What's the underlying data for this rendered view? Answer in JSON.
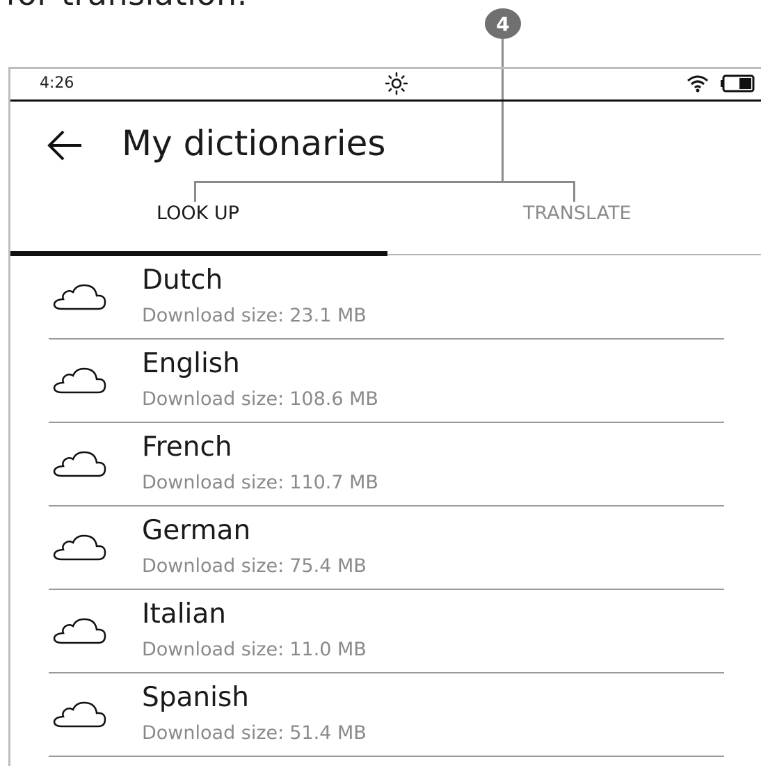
{
  "caption": "for translation.",
  "callout": {
    "number": "4"
  },
  "status_bar": {
    "time": "4:26",
    "light_icon": "sun-icon",
    "wifi_icon": "wifi-icon",
    "battery_icon": "battery-icon"
  },
  "header": {
    "back_icon": "arrow-left-icon",
    "title": "My dictionaries"
  },
  "tabs": [
    {
      "label": "LOOK UP",
      "active": true
    },
    {
      "label": "TRANSLATE",
      "active": false
    }
  ],
  "dictionaries": [
    {
      "name": "Dutch",
      "size_label": "Download size:",
      "size": "23.1 MB",
      "icon": "cloud-icon"
    },
    {
      "name": "English",
      "size_label": "Download size:",
      "size": "108.6 MB",
      "icon": "cloud-icon"
    },
    {
      "name": "French",
      "size_label": "Download size:",
      "size": "110.7 MB",
      "icon": "cloud-icon"
    },
    {
      "name": "German",
      "size_label": "Download size:",
      "size": "75.4 MB",
      "icon": "cloud-icon"
    },
    {
      "name": "Italian",
      "size_label": "Download size:",
      "size": "11.0 MB",
      "icon": "cloud-icon"
    },
    {
      "name": "Spanish",
      "size_label": "Download size:",
      "size": "51.4 MB",
      "icon": "cloud-icon"
    }
  ],
  "colors": {
    "active_tab": "#111111",
    "inactive_tab": "#8a8a8a",
    "callout": "#707070"
  }
}
